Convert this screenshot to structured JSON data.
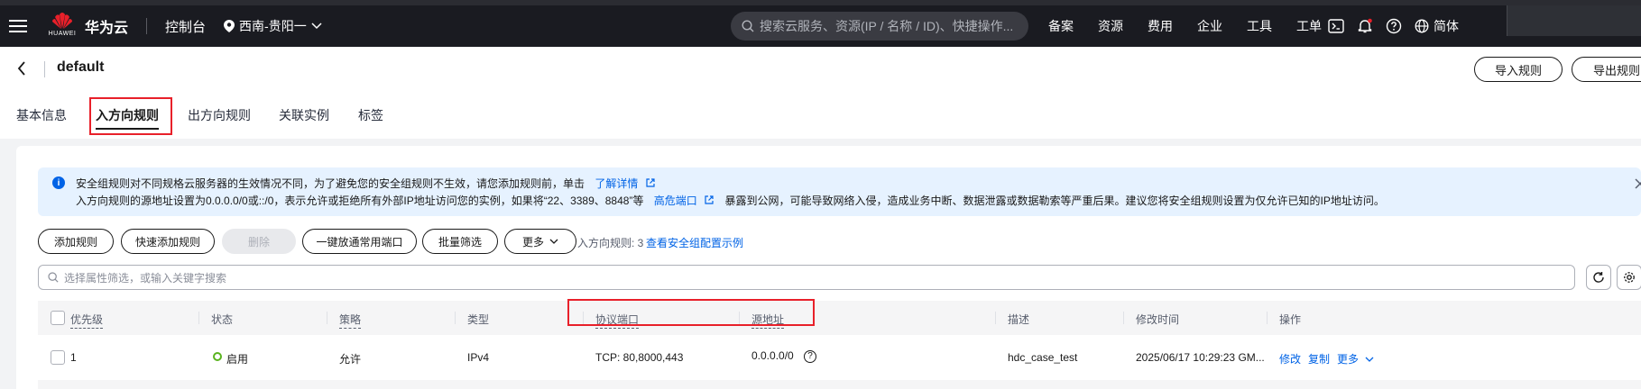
{
  "topbar": {
    "brand": "华为云",
    "logo_text": "HUAWEI",
    "console": "控制台",
    "region": "西南-贵阳一",
    "search_placeholder": "搜索云服务、资源(IP / 名称 / ID)、快捷操作...",
    "links": [
      "备案",
      "资源",
      "费用",
      "企业",
      "工具",
      "工单"
    ],
    "language": "简体"
  },
  "header": {
    "title": "default",
    "import_label": "导入规则",
    "export_label": "导出规则"
  },
  "tabs": [
    "基本信息",
    "入方向规则",
    "出方向规则",
    "关联实例",
    "标签"
  ],
  "active_tab": "入方向规则",
  "alert": {
    "line1": "安全组规则对不同规格云服务器的生效情况不同，为了避免您的安全组规则不生效，请您添加规则前，单击",
    "line1_link": "了解详情",
    "line2_pre": "入方向规则的源地址设置为0.0.0.0/0或::/0，表示允许或拒绝所有外部IP地址访问您的实例，如果将“22、3389、8848”等",
    "line2_link": "高危端口",
    "line2_post": "暴露到公网，可能导致网络入侵，造成业务中断、数据泄露或数据勒索等严重后果。建议您将安全组规则设置为仅允许已知的IP地址访问。"
  },
  "toolbar": {
    "add_rule": "添加规则",
    "quick_add": "快速添加规则",
    "delete": "删除",
    "open_ports": "一键放通常用端口",
    "batch_filter": "批量筛选",
    "more": "更多",
    "rule_count": "入方向规则: 3",
    "example_link": "查看安全组配置示例"
  },
  "filter": {
    "placeholder": "选择属性筛选，或输入关键字搜索"
  },
  "table": {
    "headers": [
      "优先级",
      "状态",
      "策略",
      "类型",
      "协议端口",
      "源地址",
      "描述",
      "修改时间",
      "操作"
    ],
    "rows": [
      {
        "priority": "1",
        "status": "启用",
        "policy": "允许",
        "type": "IPv4",
        "protocol_port": "TCP: 80,8000,443",
        "source": "0.0.0.0/0",
        "description": "hdc_case_test",
        "modified": "2025/06/17 10:29:23 GM...",
        "actions": [
          "修改",
          "复制",
          "更多"
        ]
      }
    ]
  },
  "colors": {
    "accent": "#0063e6",
    "highlight": "#e8202a",
    "status_ok": "#5ab31f"
  }
}
